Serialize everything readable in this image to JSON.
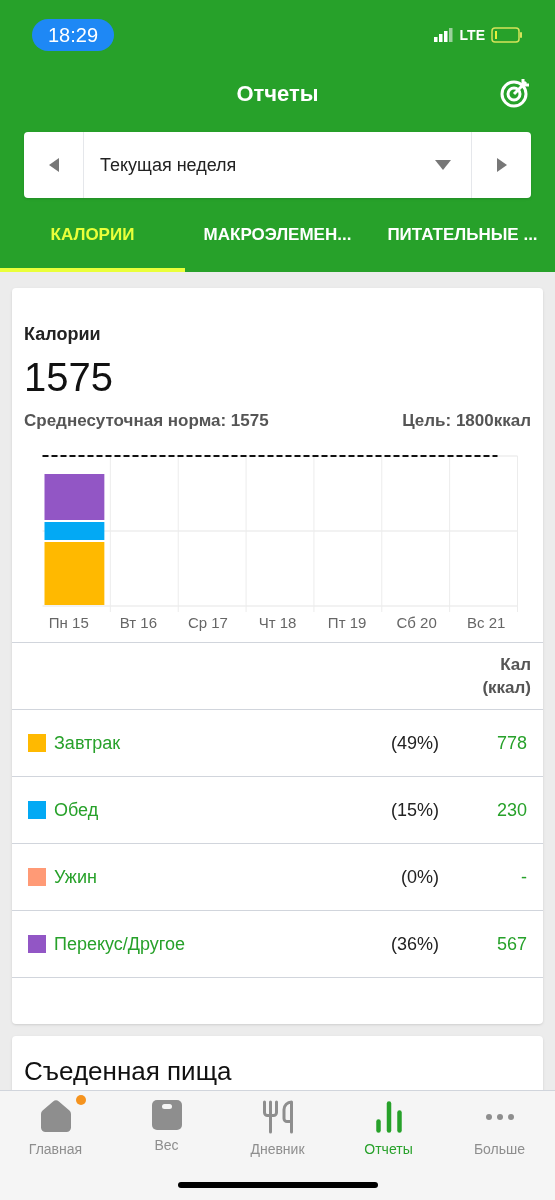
{
  "status_bar": {
    "time": "18:29",
    "network": "LTE"
  },
  "header": {
    "title": "Отчеты"
  },
  "period_selector": {
    "value": "Текущая неделя"
  },
  "tabs": [
    {
      "label": "КАЛОРИИ",
      "selected": true
    },
    {
      "label": "МАКРОЭЛЕМЕН...",
      "selected": false
    },
    {
      "label": "ПИТАТЕЛЬНЫЕ ...",
      "selected": false
    }
  ],
  "calories_card": {
    "title": "Калории",
    "total": "1575",
    "daily_average": "Среднесуточная норма: 1575",
    "goal": "Цель: 1800ккал",
    "chart_days": [
      "Пн 15",
      "Вт 16",
      "Ср 17",
      "Чт 18",
      "Пт 19",
      "Сб 20",
      "Вс 21"
    ],
    "table_header": "Кал (ккал)",
    "rows": [
      {
        "meal": "Завтрак",
        "color": "#ffb900",
        "percent": "(49%)",
        "calories": "778"
      },
      {
        "meal": "Обед",
        "color": "#03a9f4",
        "percent": "(15%)",
        "calories": "230"
      },
      {
        "meal": "Ужин",
        "color": "#ff9a76",
        "percent": "(0%)",
        "calories": "-"
      },
      {
        "meal": "Перекус/Другое",
        "color": "#9256c5",
        "percent": "(36%)",
        "calories": "567"
      }
    ]
  },
  "food_card": {
    "title": "Съеденная пища"
  },
  "bottom_nav": [
    {
      "label": "Главная",
      "kind": "home",
      "selected": false,
      "badge": true
    },
    {
      "label": "Вес",
      "kind": "weight",
      "selected": false,
      "badge": false
    },
    {
      "label": "Дневник",
      "kind": "diary",
      "selected": false,
      "badge": false
    },
    {
      "label": "Отчеты",
      "kind": "reports",
      "selected": true,
      "badge": false
    },
    {
      "label": "Больше",
      "kind": "more",
      "selected": false,
      "badge": false
    }
  ]
}
